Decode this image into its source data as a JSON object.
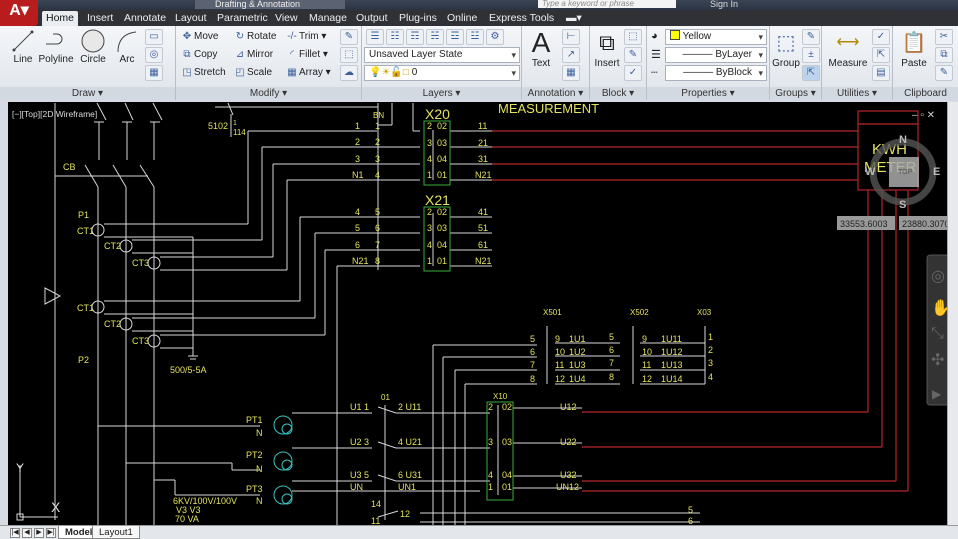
{
  "titlebar": {
    "workspace": "Drafting & Annotation",
    "search_placeholder": "Type a keyword or phrase",
    "sign_in": "Sign In"
  },
  "tabs": [
    "Home",
    "Insert",
    "Annotate",
    "Layout",
    "Parametric",
    "View",
    "Manage",
    "Output",
    "Plug-ins",
    "Online",
    "Express Tools"
  ],
  "ribbon": {
    "draw": {
      "title": "Draw",
      "line": "Line",
      "polyline": "Polyline",
      "circle": "Circle",
      "arc": "Arc"
    },
    "modify": {
      "title": "Modify",
      "move": "Move",
      "rotate": "Rotate",
      "trim": "Trim",
      "copy": "Copy",
      "mirror": "Mirror",
      "fillet": "Fillet",
      "stretch": "Stretch",
      "scale": "Scale",
      "array": "Array"
    },
    "layers": {
      "title": "Layers",
      "layer_state": "Unsaved Layer State",
      "current_layer": "0"
    },
    "annotation": {
      "title": "Annotation",
      "text": "Text"
    },
    "block": {
      "title": "Block",
      "insert": "Insert"
    },
    "properties": {
      "title": "Properties",
      "color": "Yellow",
      "color_hex": "#ffff00",
      "linetype": "ByLayer",
      "lineweight": "ByBlock"
    },
    "groups": {
      "title": "Groups",
      "group": "Group"
    },
    "utilities": {
      "title": "Utilities",
      "measure": "Measure"
    },
    "clipboard": {
      "title": "Clipboard",
      "paste": "Paste"
    }
  },
  "viewport": {
    "label": "[−][Top][2D Wireframe]"
  },
  "viewcube": {
    "n": "N",
    "s": "S",
    "e": "E",
    "w": "W",
    "top": "TOP"
  },
  "coords": {
    "x": "33553.6003",
    "y": "23880.3070"
  },
  "ucs": {
    "x": "X",
    "y": "Y"
  },
  "drawing": {
    "measurement": "MEASUREMENT",
    "kwh": "KWH",
    "meter": "METER",
    "cb": "CB",
    "p1": "P1",
    "p2": "P2",
    "s5102": "5102",
    "s1": "1",
    "s114": "114",
    "ct": [
      "CT1",
      "CT2",
      "CT3",
      "CT1",
      "CT2",
      "CT3"
    ],
    "ratio": "500/5-5A",
    "bn": "BN",
    "bn_left": [
      "1",
      "2",
      "3",
      "N1",
      "4",
      "5",
      "6",
      "N21"
    ],
    "bn_right": [
      "1",
      "2",
      "3",
      "4",
      "5",
      "6",
      "7",
      "8"
    ],
    "x20": "X20",
    "x21": "X21",
    "term_left": [
      "2",
      "3",
      "4",
      "1"
    ],
    "term_right": [
      "02",
      "03",
      "04",
      "01"
    ],
    "x20_out": [
      "11",
      "21",
      "31",
      "N21"
    ],
    "x21_out": [
      "41",
      "51",
      "61",
      "N21"
    ],
    "x501": "X501",
    "x502": "X502",
    "x03": "X03",
    "x501_in": [
      "5",
      "6",
      "7",
      "8"
    ],
    "x501_num": [
      "9",
      "10",
      "11",
      "12"
    ],
    "x501_sig": [
      "1U1",
      "1U2",
      "1U3",
      "1U4"
    ],
    "x502_in": [
      "5",
      "6",
      "7",
      "8"
    ],
    "x502_num": [
      "9",
      "10",
      "11",
      "12"
    ],
    "x502_sig": [
      "1U11",
      "1U12",
      "1U13",
      "1U14"
    ],
    "x03_out": [
      "1",
      "2",
      "3",
      "4"
    ],
    "pt": [
      "PT1",
      "PT2",
      "PT3"
    ],
    "n": "N",
    "pt_rating": "6KV/100V/100V",
    "v3": "V3   V3",
    "va": "70 VA",
    "sw01": "01",
    "u_in": [
      "U1  1",
      "U2  3",
      "U3  5",
      "UN"
    ],
    "u_out": [
      "2  U11",
      "4  U21",
      "6  U31",
      "UN1"
    ],
    "s14": "14",
    "s11": "11",
    "s12": "12",
    "x10": "X10",
    "x10_left": [
      "2",
      "3",
      "4",
      "1"
    ],
    "x10_right": [
      "02",
      "03",
      "04",
      "01"
    ],
    "u_final": [
      "U12",
      "U22",
      "U32",
      "UN12"
    ],
    "bottom": [
      "5",
      "6"
    ]
  },
  "layout_tabs": [
    "Model",
    "Layout1"
  ]
}
